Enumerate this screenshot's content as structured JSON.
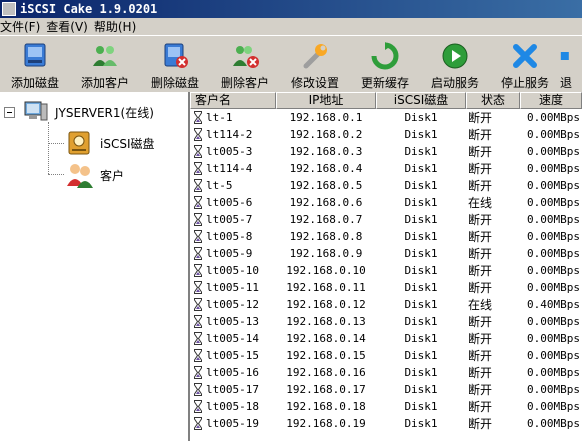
{
  "window": {
    "title": "iSCSI Cake 1.9.0201"
  },
  "menu": [
    "文件(F)",
    "查看(V)",
    "帮助(H)"
  ],
  "toolbar": [
    {
      "label": "添加磁盘",
      "icon": "add-disk-icon"
    },
    {
      "label": "添加客户",
      "icon": "add-client-icon"
    },
    {
      "label": "删除磁盘",
      "icon": "delete-disk-icon"
    },
    {
      "label": "删除客户",
      "icon": "delete-client-icon"
    },
    {
      "label": "修改设置",
      "icon": "wrench-icon"
    },
    {
      "label": "更新缓存",
      "icon": "refresh-icon"
    },
    {
      "label": "启动服务",
      "icon": "play-icon"
    },
    {
      "label": "停止服务",
      "icon": "stop-icon"
    },
    {
      "label": "退",
      "icon": "exit-icon"
    }
  ],
  "tree": {
    "root": "JYSERVER1(在线)",
    "children": [
      "iSCSI磁盘",
      "客户"
    ]
  },
  "table": {
    "columns": [
      "客户名",
      "IP地址",
      "iSCSI磁盘",
      "状态",
      "速度"
    ],
    "rows": [
      [
        "lt-1",
        "192.168.0.1",
        "Disk1",
        "断开",
        "0.00MBps"
      ],
      [
        "lt114-2",
        "192.168.0.2",
        "Disk1",
        "断开",
        "0.00MBps"
      ],
      [
        "lt005-3",
        "192.168.0.3",
        "Disk1",
        "断开",
        "0.00MBps"
      ],
      [
        "lt114-4",
        "192.168.0.4",
        "Disk1",
        "断开",
        "0.00MBps"
      ],
      [
        "lt-5",
        "192.168.0.5",
        "Disk1",
        "断开",
        "0.00MBps"
      ],
      [
        "lt005-6",
        "192.168.0.6",
        "Disk1",
        "在线",
        "0.00MBps"
      ],
      [
        "lt005-7",
        "192.168.0.7",
        "Disk1",
        "断开",
        "0.00MBps"
      ],
      [
        "lt005-8",
        "192.168.0.8",
        "Disk1",
        "断开",
        "0.00MBps"
      ],
      [
        "lt005-9",
        "192.168.0.9",
        "Disk1",
        "断开",
        "0.00MBps"
      ],
      [
        "lt005-10",
        "192.168.0.10",
        "Disk1",
        "断开",
        "0.00MBps"
      ],
      [
        "lt005-11",
        "192.168.0.11",
        "Disk1",
        "断开",
        "0.00MBps"
      ],
      [
        "lt005-12",
        "192.168.0.12",
        "Disk1",
        "在线",
        "0.40MBps"
      ],
      [
        "lt005-13",
        "192.168.0.13",
        "Disk1",
        "断开",
        "0.00MBps"
      ],
      [
        "lt005-14",
        "192.168.0.14",
        "Disk1",
        "断开",
        "0.00MBps"
      ],
      [
        "lt005-15",
        "192.168.0.15",
        "Disk1",
        "断开",
        "0.00MBps"
      ],
      [
        "lt005-16",
        "192.168.0.16",
        "Disk1",
        "断开",
        "0.00MBps"
      ],
      [
        "lt005-17",
        "192.168.0.17",
        "Disk1",
        "断开",
        "0.00MBps"
      ],
      [
        "lt005-18",
        "192.168.0.18",
        "Disk1",
        "断开",
        "0.00MBps"
      ],
      [
        "lt005-19",
        "192.168.0.19",
        "Disk1",
        "断开",
        "0.00MBps"
      ]
    ]
  },
  "colors": {
    "title_bar": "#0a246a",
    "window_bg": "#d4d0c8"
  }
}
